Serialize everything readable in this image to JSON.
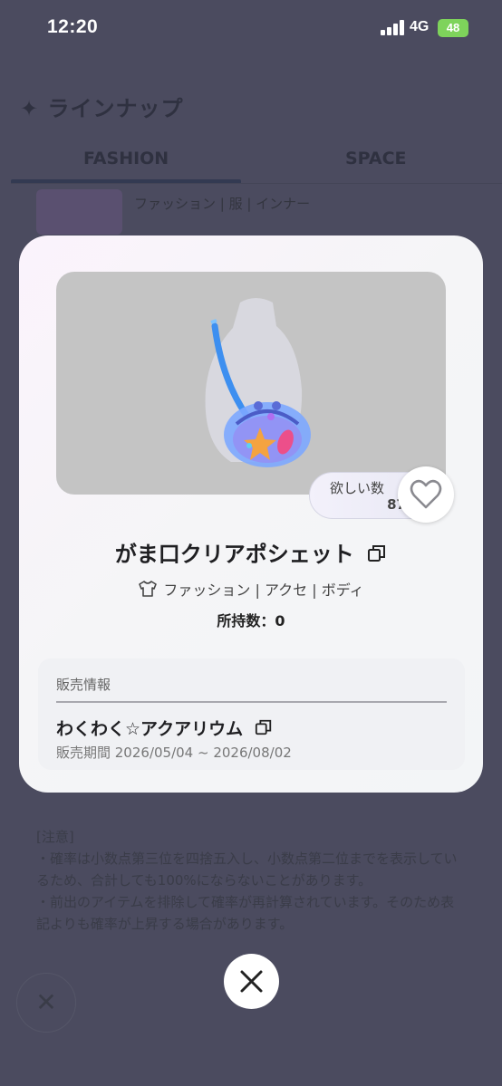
{
  "status_bar": {
    "time": "12:20",
    "network": "4G",
    "battery": "48"
  },
  "background": {
    "heading": "✦ ラインナップ",
    "tabs": [
      {
        "label": "FASHION"
      },
      {
        "label": "SPACE"
      }
    ],
    "item_category": "ファッション | 服 | インナー",
    "notes": {
      "title": "[注意]",
      "line1": "・確率は小数点第三位を四捨五入し、小数点第二位までを表示しているため、合計しても100%にならないことがあります。",
      "line2": "・前出のアイテムを排除して確率が再計算されています。そのため表記よりも確率が上昇する場合があります。"
    }
  },
  "modal": {
    "wish": {
      "label": "欲しい数",
      "count": "87"
    },
    "item": {
      "name": "がま口クリアポシェット",
      "category": "ファッション | アクセ | ボディ",
      "owned": "所持数：0"
    },
    "sale": {
      "header": "販売情報",
      "event": "わくわく☆アクアリウム",
      "period": "販売期間 2026/05/04 ~ 2026/08/02"
    }
  },
  "icons": {
    "copy": "copy-icon",
    "heart": "heart-outline-icon",
    "shirt": "shirt-icon",
    "close": "close-icon"
  },
  "colors": {
    "overlay_bg": "#4b4b5f",
    "battery": "#7ed35b",
    "image_bg": "#c4c4c4"
  }
}
